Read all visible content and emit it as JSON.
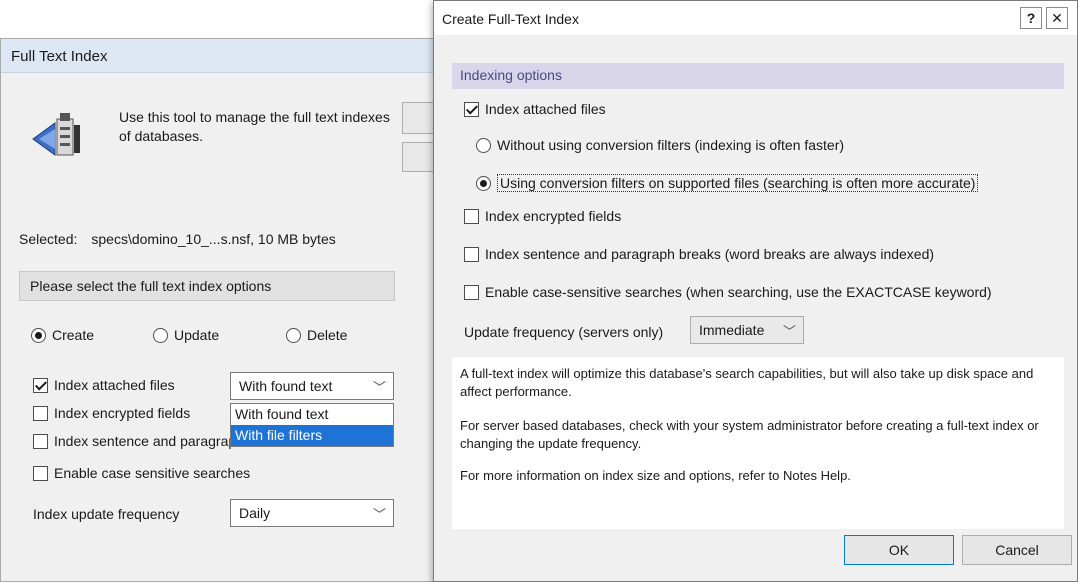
{
  "full_text_index": {
    "title": "Full Text Index",
    "description": "Use this tool to manage the full text indexes of databases.",
    "selected_label": "Selected:",
    "selected_value": "specs\\domino_10_...s.nsf, 10 MB bytes",
    "options_header": "Please select the full text index options",
    "radios": {
      "create": "Create",
      "update": "Update",
      "delete": "Delete",
      "selected": "create"
    },
    "checkboxes": {
      "attached": "Index attached files",
      "encrypted": "Index encrypted fields",
      "sentence": "Index sentence and paragraph breaks",
      "case": "Enable case sensitive searches"
    },
    "attached_combo": {
      "value": "With found text",
      "options": [
        "With found text",
        "With file filters"
      ]
    },
    "frequency_label": "Index update frequency",
    "frequency_value": "Daily"
  },
  "create_dialog": {
    "title": "Create Full-Text Index",
    "help_label": "?",
    "close_label": "✕",
    "section_header": "Indexing options",
    "index_attached": "Index attached files",
    "without_filters": "Without using conversion filters (indexing is often faster)",
    "with_filters": "Using conversion filters on supported files (searching is often more accurate)",
    "index_encrypted": "Index encrypted fields",
    "index_sentence": "Index sentence and paragraph breaks (word breaks are always indexed)",
    "case_sensitive": "Enable case-sensitive searches (when searching, use the EXACTCASE keyword)",
    "frequency_label": "Update frequency (servers only)",
    "frequency_value": "Immediate",
    "info_1": "A full-text index will optimize this database's search capabilities, but will also take up disk space and affect performance.",
    "info_2": "For server based databases, check with your system administrator before creating a full-text index or changing the update frequency.",
    "info_3": "For more information on index size and options, refer to Notes Help.",
    "ok_label": "OK",
    "cancel_label": "Cancel"
  },
  "icons": {
    "database_tool": "database-tool-icon",
    "dropdown_arrow": "chevron-down-icon"
  }
}
